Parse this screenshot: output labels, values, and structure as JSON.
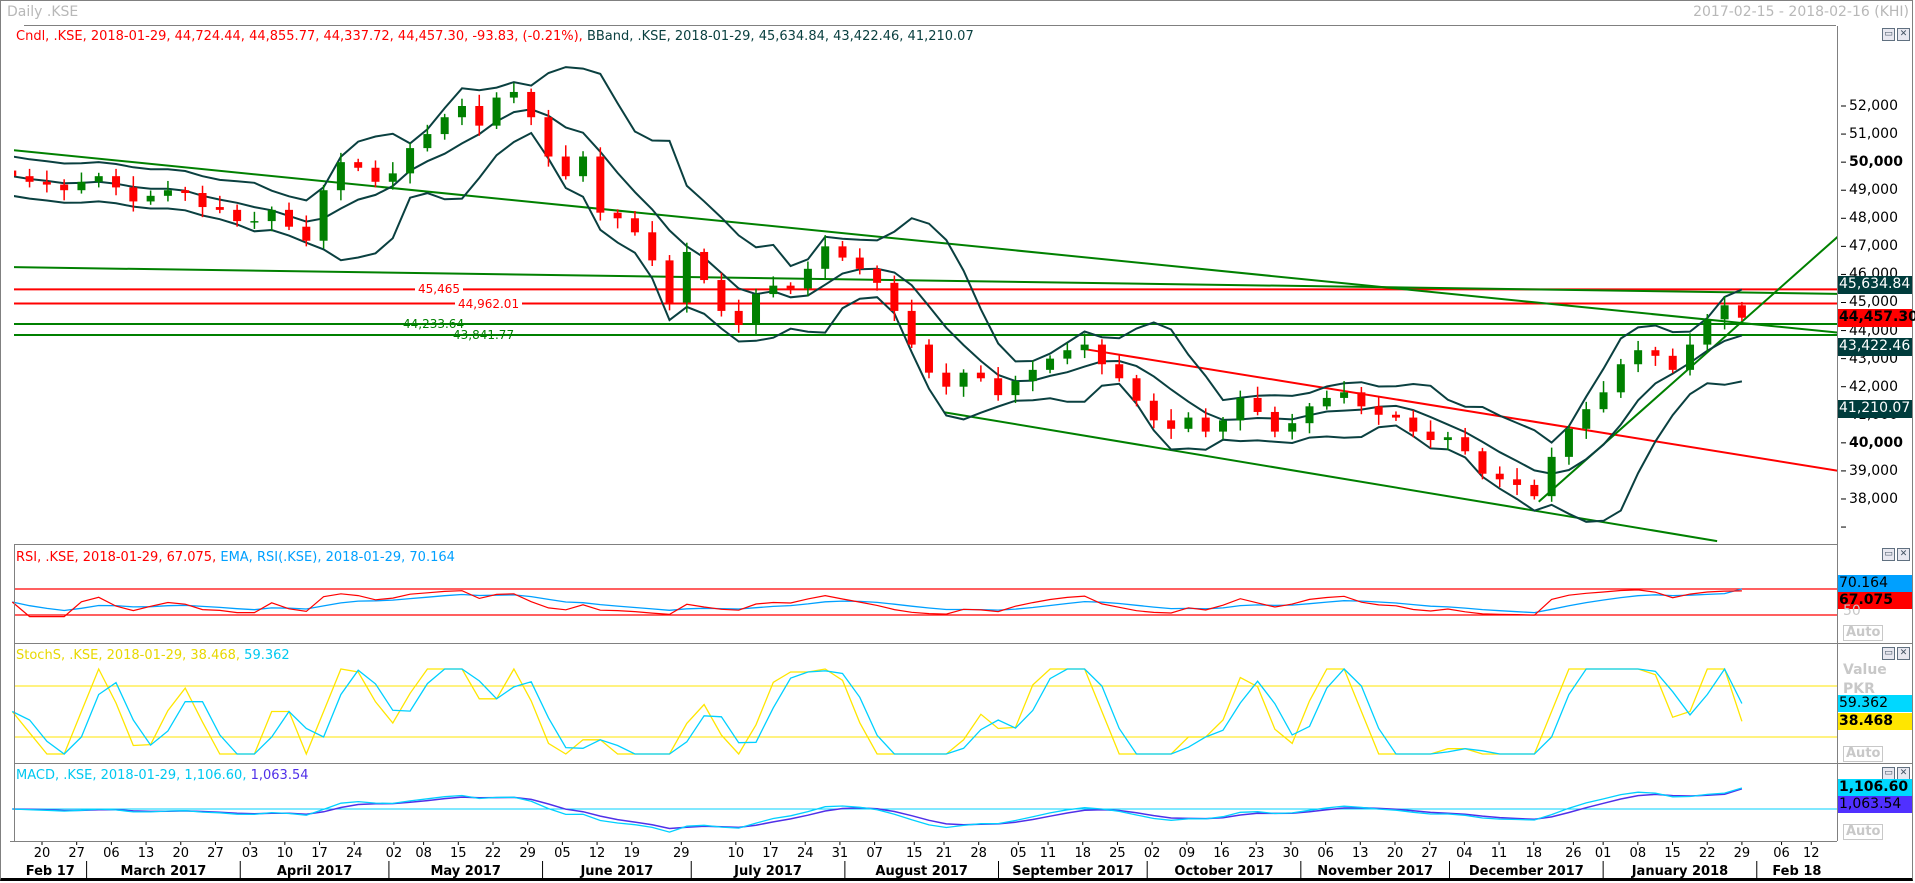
{
  "window": {
    "title": "Daily .KSE",
    "date_range": "2017-02-15 - 2018-02-16 (KHI)"
  },
  "legend": {
    "candle": "Cndl, .KSE, 2018-01-29, 44,724.44, 44,855.77, 44,337.72, 44,457.30, -93.83, (-0.21%),",
    "bband": "BBand, .KSE, 2018-01-29, 45,634.84, 43,422.46, 41,210.07",
    "rsi": "RSI, .KSE, 2018-01-29, 67.075,",
    "rsi_ema": "EMA, RSI(.KSE), 2018-01-29, 70.164",
    "stoch_k": "StochS, .KSE, 2018-01-29, 38.468,",
    "stoch_d": "59.362",
    "macd": "MACD, .KSE, 2018-01-29, 1,106.60,",
    "macd_signal": "1,063.54"
  },
  "colors": {
    "up": "#008000",
    "down": "#ff0000",
    "bband": "#0a4040",
    "rsi": "#ff0000",
    "rsi_ema": "#00a0ff",
    "stoch_k": "#ffe600",
    "stoch_d": "#00d0ff",
    "macd": "#00d0ff",
    "macd_signal": "#5030e8",
    "trend_green": "#008000",
    "trend_red": "#ff0000"
  },
  "right_axis": {
    "ticks": [
      {
        "value": 52000,
        "label": "52,000",
        "bold": false
      },
      {
        "value": 51000,
        "label": "51,000",
        "bold": false
      },
      {
        "value": 50000,
        "label": "50,000",
        "bold": true
      },
      {
        "value": 49000,
        "label": "49,000",
        "bold": false
      },
      {
        "value": 48000,
        "label": "48,000",
        "bold": false
      },
      {
        "value": 47000,
        "label": "47,000",
        "bold": false
      },
      {
        "value": 46000,
        "label": "46,000",
        "bold": false
      },
      {
        "value": 45000,
        "label": "45,000",
        "bold": false
      },
      {
        "value": 44000,
        "label": "44,000",
        "bold": false
      },
      {
        "value": 43000,
        "label": "43,000",
        "bold": false
      },
      {
        "value": 42000,
        "label": "42,000",
        "bold": false
      },
      {
        "value": 41000,
        "label": "41,000",
        "bold": false
      },
      {
        "value": 40000,
        "label": "40,000",
        "bold": true
      },
      {
        "value": 39000,
        "label": "39,000",
        "bold": false
      },
      {
        "value": 38000,
        "label": "38,000",
        "bold": false
      },
      {
        "value": 37000,
        "label": "",
        "bold": false
      }
    ],
    "value_boxes": [
      {
        "value": 45634.84,
        "label": "45,634.84",
        "bg": "#003c3c",
        "fg": "#ffffff",
        "bold": false
      },
      {
        "value": 44457.3,
        "label": "44,457.30",
        "bg": "#ff0000",
        "fg": "#000000",
        "bold": true
      },
      {
        "value": 43422.46,
        "label": "43,422.46",
        "bg": "#003c3c",
        "fg": "#ffffff",
        "bold": false
      },
      {
        "value": 41210.07,
        "label": "41,210.07",
        "bg": "#003c3c",
        "fg": "#ffffff",
        "bold": false
      }
    ]
  },
  "rsi_panel": {
    "ema_box": "70.164",
    "rsi_box": "67.075",
    "mid_label": "50",
    "auto": "Auto",
    "levels": [
      70,
      30
    ]
  },
  "stoch_panel": {
    "value_label": "Value",
    "currency_label": "PKR",
    "d_box": "59.362",
    "k_box": "38.468",
    "auto": "Auto",
    "levels": [
      80,
      20
    ]
  },
  "macd_panel": {
    "macd_box": "1,106.60",
    "signal_box": "1,063.54",
    "auto": "Auto"
  },
  "x_axis": {
    "day_ticks": [
      {
        "date": "2017-02-20",
        "label": "20"
      },
      {
        "date": "2017-02-27",
        "label": "27"
      },
      {
        "date": "2017-03-06",
        "label": "06"
      },
      {
        "date": "2017-03-13",
        "label": "13"
      },
      {
        "date": "2017-03-20",
        "label": "20"
      },
      {
        "date": "2017-03-27",
        "label": "27"
      },
      {
        "date": "2017-04-03",
        "label": "03"
      },
      {
        "date": "2017-04-10",
        "label": "10"
      },
      {
        "date": "2017-04-17",
        "label": "17"
      },
      {
        "date": "2017-04-24",
        "label": "24"
      },
      {
        "date": "2017-05-02",
        "label": "02"
      },
      {
        "date": "2017-05-08",
        "label": "08"
      },
      {
        "date": "2017-05-15",
        "label": "15"
      },
      {
        "date": "2017-05-22",
        "label": "22"
      },
      {
        "date": "2017-05-29",
        "label": "29"
      },
      {
        "date": "2017-06-05",
        "label": "05"
      },
      {
        "date": "2017-06-12",
        "label": "12"
      },
      {
        "date": "2017-06-19",
        "label": "19"
      },
      {
        "date": "2017-06-29",
        "label": "29"
      },
      {
        "date": "2017-07-10",
        "label": "10"
      },
      {
        "date": "2017-07-17",
        "label": "17"
      },
      {
        "date": "2017-07-24",
        "label": "24"
      },
      {
        "date": "2017-07-31",
        "label": "31"
      },
      {
        "date": "2017-08-07",
        "label": "07"
      },
      {
        "date": "2017-08-15",
        "label": "15"
      },
      {
        "date": "2017-08-21",
        "label": "21"
      },
      {
        "date": "2017-08-28",
        "label": "28"
      },
      {
        "date": "2017-09-05",
        "label": "05"
      },
      {
        "date": "2017-09-11",
        "label": "11"
      },
      {
        "date": "2017-09-18",
        "label": "18"
      },
      {
        "date": "2017-09-25",
        "label": "25"
      },
      {
        "date": "2017-10-02",
        "label": "02"
      },
      {
        "date": "2017-10-09",
        "label": "09"
      },
      {
        "date": "2017-10-16",
        "label": "16"
      },
      {
        "date": "2017-10-23",
        "label": "23"
      },
      {
        "date": "2017-10-30",
        "label": "30"
      },
      {
        "date": "2017-11-06",
        "label": "06"
      },
      {
        "date": "2017-11-13",
        "label": "13"
      },
      {
        "date": "2017-11-20",
        "label": "20"
      },
      {
        "date": "2017-11-27",
        "label": "27"
      },
      {
        "date": "2017-12-04",
        "label": "04"
      },
      {
        "date": "2017-12-11",
        "label": "11"
      },
      {
        "date": "2017-12-18",
        "label": "18"
      },
      {
        "date": "2017-12-26",
        "label": "26"
      },
      {
        "date": "2018-01-01",
        "label": "01"
      },
      {
        "date": "2018-01-08",
        "label": "08"
      },
      {
        "date": "2018-01-15",
        "label": "15"
      },
      {
        "date": "2018-01-22",
        "label": "22"
      },
      {
        "date": "2018-01-29",
        "label": "29"
      },
      {
        "date": "2018-02-06",
        "label": "06"
      },
      {
        "date": "2018-02-12",
        "label": "12"
      }
    ],
    "months": [
      {
        "start": "2017-02-14",
        "end": "2017-03-01",
        "label": "Feb 17"
      },
      {
        "start": "2017-03-01",
        "end": "2017-04-01",
        "label": "March 2017"
      },
      {
        "start": "2017-04-01",
        "end": "2017-05-01",
        "label": "April 2017"
      },
      {
        "start": "2017-05-01",
        "end": "2017-06-01",
        "label": "May 2017"
      },
      {
        "start": "2017-06-01",
        "end": "2017-07-01",
        "label": "June 2017"
      },
      {
        "start": "2017-07-01",
        "end": "2017-08-01",
        "label": "July 2017"
      },
      {
        "start": "2017-08-01",
        "end": "2017-09-01",
        "label": "August 2017"
      },
      {
        "start": "2017-09-01",
        "end": "2017-10-01",
        "label": "September 2017"
      },
      {
        "start": "2017-10-01",
        "end": "2017-11-01",
        "label": "October 2017"
      },
      {
        "start": "2017-11-01",
        "end": "2017-12-01",
        "label": "November 2017"
      },
      {
        "start": "2017-12-01",
        "end": "2018-01-01",
        "label": "December 2017"
      },
      {
        "start": "2018-01-01",
        "end": "2018-02-01",
        "label": "January 2018"
      },
      {
        "start": "2018-02-01",
        "end": "2018-02-20",
        "label": "Feb 18"
      }
    ]
  },
  "chart_data": {
    "type": "candlestick",
    "title": "Daily .KSE",
    "series_start": "2017-02-14",
    "series_end": "2018-01-29",
    "closes": [
      49500,
      49300,
      49200,
      49000,
      49300,
      49500,
      49100,
      48600,
      48800,
      49000,
      48900,
      48400,
      48300,
      47900,
      47900,
      48300,
      47700,
      47200,
      49000,
      50000,
      49800,
      49300,
      49600,
      50500,
      51000,
      51600,
      52000,
      51300,
      52300,
      52500,
      51600,
      50200,
      49500,
      50200,
      48200,
      48000,
      47500,
      46500,
      45000,
      46800,
      45800,
      44700,
      44200,
      45300,
      45600,
      45500,
      46200,
      47000,
      46600,
      46200,
      45700,
      44700,
      43500,
      42500,
      42000,
      42500,
      42300,
      41700,
      42200,
      42600,
      43000,
      43300,
      43500,
      42800,
      42300,
      41500,
      40800,
      40500,
      40900,
      40400,
      40800,
      41600,
      41100,
      40400,
      40700,
      41300,
      41600,
      41800,
      41300,
      41000,
      40900,
      40400,
      40100,
      40200,
      39700,
      38900,
      38700,
      38500,
      38100,
      39500,
      40500,
      41200,
      41800,
      42800,
      43300,
      43100,
      42600,
      43500,
      44400,
      44900,
      44457.3
    ],
    "last_candle": {
      "date": "2018-01-29",
      "open": 44724.44,
      "high": 44855.77,
      "low": 44337.72,
      "close": 44457.3,
      "change": -93.83,
      "change_pct": -0.21
    },
    "bband_last": {
      "upper": 45634.84,
      "middle": 43422.46,
      "lower": 41210.07
    },
    "ylim": [
      36600,
      53200
    ],
    "horizontal_lines": [
      {
        "value": 45465,
        "label": "45,465",
        "color": "red"
      },
      {
        "value": 44962.01,
        "label": "44,962.01",
        "color": "red"
      },
      {
        "value": 44233.64,
        "label": "44,233.64",
        "color": "green"
      },
      {
        "value": 43841.77,
        "label": "43,841.77",
        "color": "green"
      }
    ],
    "trend_lines": [
      {
        "from": [
          "2017-02-14",
          50430
        ],
        "to": [
          "2018-02-20",
          43880
        ],
        "color": "green"
      },
      {
        "from": [
          "2017-02-14",
          46260
        ],
        "to": [
          "2018-02-20",
          45300
        ],
        "color": "green"
      },
      {
        "from": [
          "2017-09-18",
          43350
        ],
        "to": [
          "2018-02-20",
          38930
        ],
        "color": "red"
      },
      {
        "from": [
          "2017-08-21",
          41090
        ],
        "to": [
          "2018-01-24",
          36500
        ],
        "color": "green"
      },
      {
        "from": [
          "2017-12-19",
          37900
        ],
        "to": [
          "2018-02-20",
          47760
        ],
        "color": "green"
      }
    ],
    "rsi_last": 67.075,
    "rsi_ema_last": 70.164,
    "stoch_k_last": 38.468,
    "stoch_d_last": 59.362,
    "macd_last": 1106.6,
    "macd_signal_last": 1063.54
  }
}
